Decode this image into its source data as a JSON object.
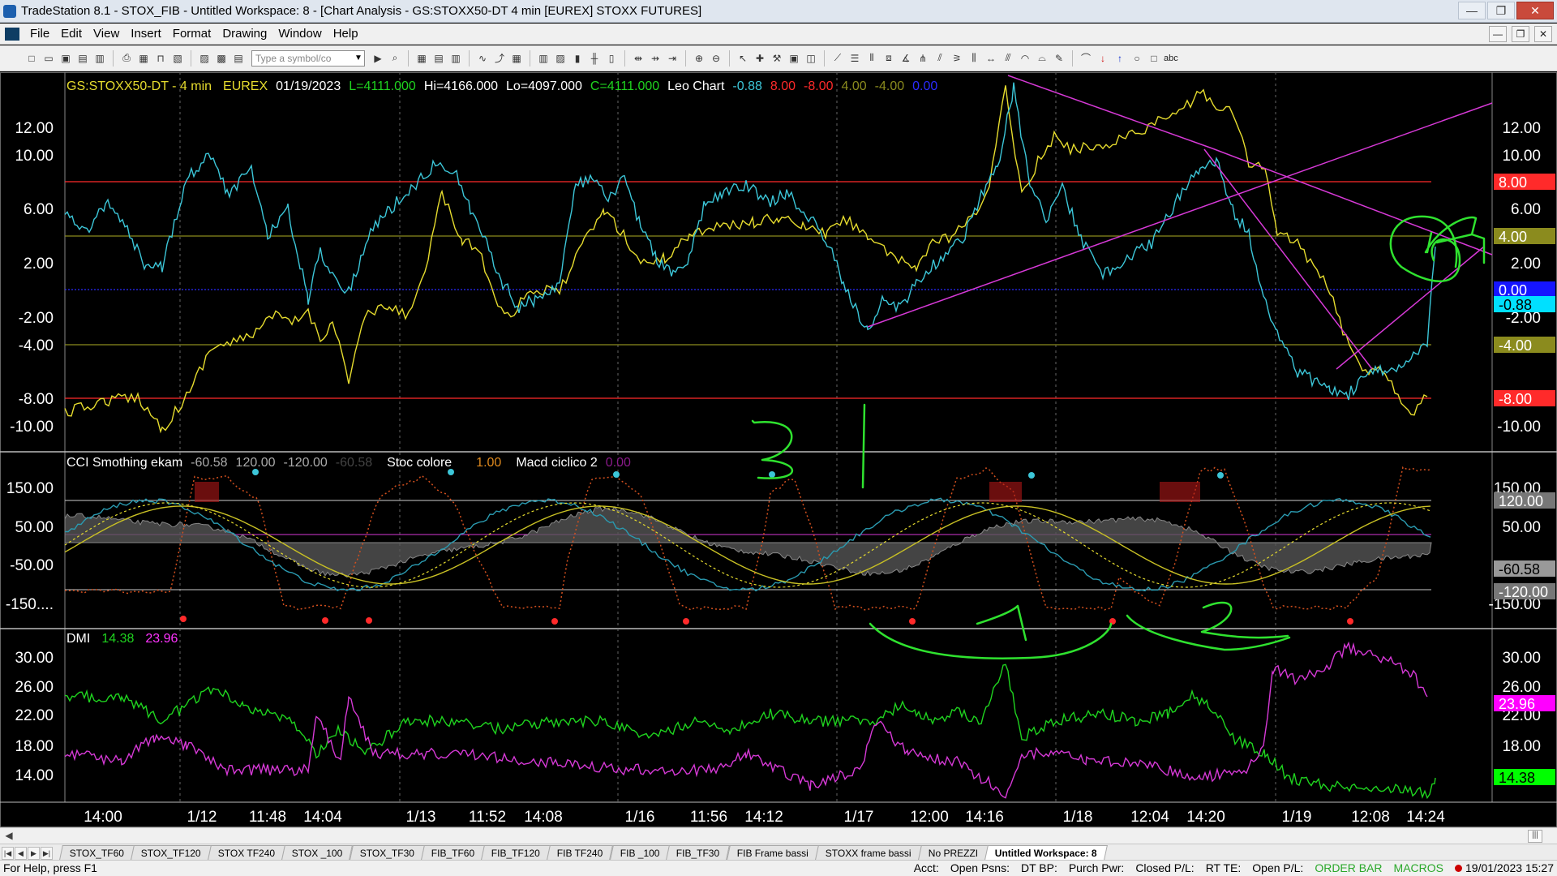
{
  "window": {
    "title": "TradeStation 8.1 - STOX_FIB - Untitled Workspace:  8 - [Chart Analysis - GS:STOXX50-DT  4 min  [EUREX] STOXX FUTURES]",
    "buttons": [
      "—",
      "❐",
      "✕"
    ]
  },
  "menu": {
    "items": [
      "File",
      "Edit",
      "View",
      "Insert",
      "Format",
      "Drawing",
      "Window",
      "Help"
    ],
    "mdi_buttons": [
      "—",
      "❐",
      "✕"
    ]
  },
  "toolbar": {
    "symbol_placeholder": "Type a symbol/co",
    "abc_label": "abc"
  },
  "chart_header": {
    "symbol": "GS:STOXX50-DT - 4 min",
    "exchange": "EUREX",
    "date": "01/19/2023",
    "last": "L=4111.000",
    "high": "Hi=4166.000",
    "low": "Lo=4097.000",
    "close": "C=4111.000",
    "study": "Leo Chart",
    "vals": [
      "-0.88",
      "8.00",
      "-8.00",
      "4.00",
      "-4.00",
      "0.00"
    ]
  },
  "panel1": {
    "yticks": [
      "12.00",
      "10.00",
      "6.00",
      "2.00",
      "-2.00",
      "-4.00",
      "-8.00",
      "-10.00"
    ],
    "right_tags": [
      "8.00",
      "4.00",
      "0.00",
      "-0.88",
      "-4.00",
      "-8.00"
    ]
  },
  "panel2": {
    "header": {
      "name1": "CCI Smothing ekam",
      "v1": "-60.58",
      "v2": "120.00",
      "v3": "-120.00",
      "v4": "-60.58",
      "name2": "Stoc colore",
      "v5": "1.00",
      "name3": "Macd ciclico 2",
      "v6": "0.00"
    },
    "yticks": [
      "150.00",
      "50.00",
      "-50.00",
      "-150...."
    ],
    "right_ticks": [
      "150.00",
      "50.00",
      "-150.00"
    ],
    "right_tags": [
      "120.00",
      "-60.58",
      "-120.00"
    ]
  },
  "panel3": {
    "header": {
      "name": "DMI",
      "v1": "14.38",
      "v2": "23.96"
    },
    "yticks": [
      "30.00",
      "26.00",
      "22.00",
      "18.00",
      "14.00"
    ],
    "right_tags": [
      "23.96",
      "14.38"
    ]
  },
  "xaxis": [
    "14:00",
    "1/12",
    "11:48",
    "14:04",
    "1/13",
    "11:52",
    "14:08",
    "1/16",
    "11:56",
    "14:12",
    "1/17",
    "12:00",
    "14:16",
    "1/18",
    "12:04",
    "14:20",
    "1/19",
    "12:08",
    "14:24"
  ],
  "tabs": [
    "STOX_TF60",
    "STOX_TF120",
    "STOX TF240",
    "STOX _100",
    "STOX_TF30",
    "FIB_TF60",
    "FIB_TF120",
    "FIB TF240",
    "FIB _100",
    "FIB_TF30",
    "FIB Frame bassi",
    "STOXX frame bassi",
    "No PREZZI",
    "Untitled Workspace:  8"
  ],
  "status": {
    "help": "For Help, press F1",
    "fields": [
      "Acct:",
      "Open Psns:",
      "DT BP:",
      "Purch Pwr:",
      "Closed P/L:",
      "RT TE:",
      "Open P/L:"
    ],
    "green": [
      "ORDER BAR",
      "MACROS"
    ],
    "datetime": "19/01/2023 15:27"
  },
  "colors": {
    "cyan": "#3cc6d8",
    "yellow": "#e6dc2e",
    "magenta": "#d639d6",
    "green": "#1fd41f",
    "red": "#ff2a2a",
    "olive": "#8b8b1e",
    "blue": "#2b2bff",
    "annot": "#2fe22f"
  },
  "annotations": [
    "3",
    "1",
    "2",
    "4"
  ]
}
